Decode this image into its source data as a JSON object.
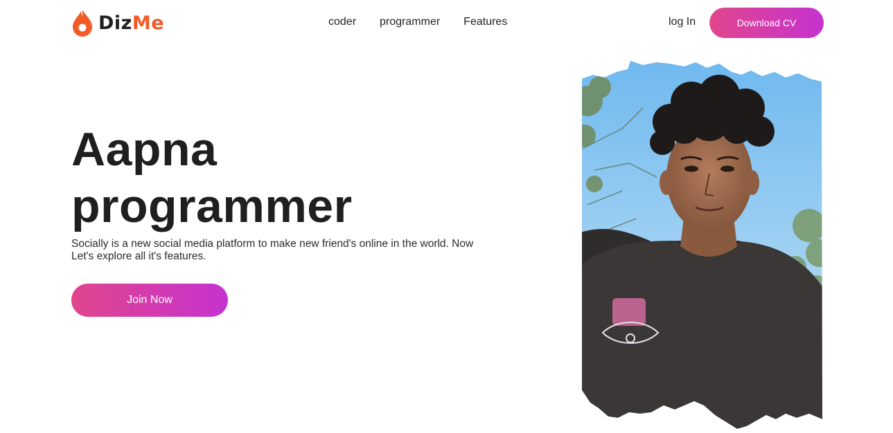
{
  "brand": {
    "name_part1": "Diz",
    "name_part2": "Me",
    "logo_icon": "flame-drop-icon",
    "accent_color": "#f25a28"
  },
  "nav": {
    "items": [
      {
        "label": "coder"
      },
      {
        "label": "programmer"
      },
      {
        "label": "Features"
      }
    ],
    "login_label": "log In",
    "download_label": "Download CV"
  },
  "hero": {
    "title_line1": "Aapna",
    "title_line2": "programmer",
    "description": "Socially is a new social media platform to make new friend's online in the world. Now Let's explore all it's features.",
    "cta_label": "Join Now"
  },
  "photo": {
    "subject": "portrait-photo"
  },
  "colors": {
    "gradient_start": "#e0468c",
    "gradient_end": "#c632d0",
    "text": "#222222"
  }
}
